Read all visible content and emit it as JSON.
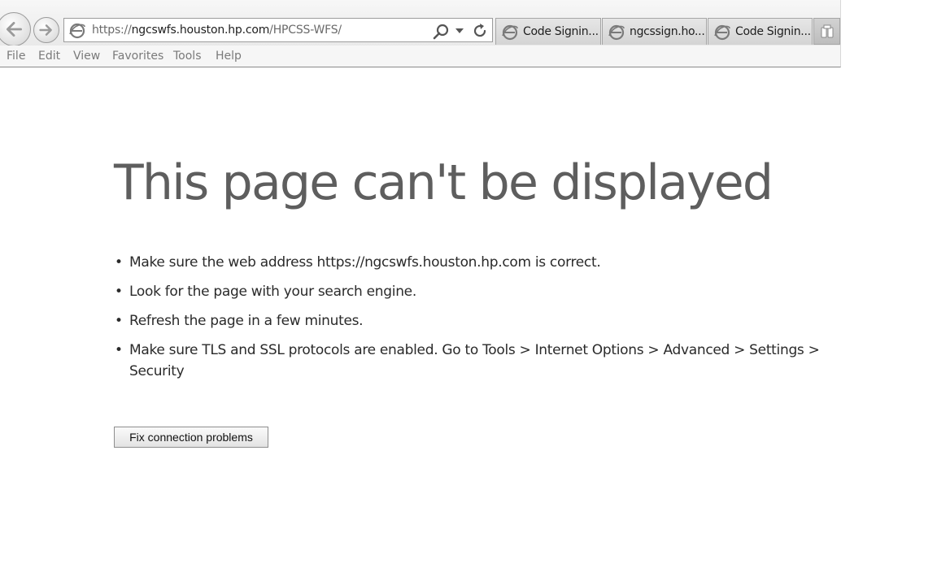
{
  "browser": {
    "address": {
      "protocol": "https://",
      "host": "ngcswfs.houston.hp.com",
      "path": "/HPCSS-WFS/"
    },
    "tabs": [
      {
        "label": "Code Signin...",
        "icon": "ie-icon"
      },
      {
        "label": "ngcssign.ho...",
        "icon": "ie-icon"
      },
      {
        "label": "Code Signin...",
        "icon": "ie-icon"
      }
    ],
    "icons": {
      "back": "back-arrow-icon",
      "forward": "forward-arrow-icon",
      "search": "search-icon",
      "dropdown": "chevron-down-icon",
      "refresh": "refresh-icon",
      "new_tab": "new-tab-icon"
    }
  },
  "menu": {
    "file": "File",
    "edit": "Edit",
    "view": "View",
    "favorites": "Favorites",
    "tools": "Tools",
    "help": "Help"
  },
  "error_page": {
    "title": "This page can't be displayed",
    "bullet": "•",
    "suggestions": [
      "Make sure the web address https://ngcswfs.houston.hp.com is correct.",
      "Look for the page with your search engine.",
      "Refresh the page in a few minutes.",
      "Make sure TLS and SSL protocols are enabled. Go to Tools > Internet Options > Advanced > Settings > Security"
    ],
    "fix_button": "Fix connection problems"
  }
}
